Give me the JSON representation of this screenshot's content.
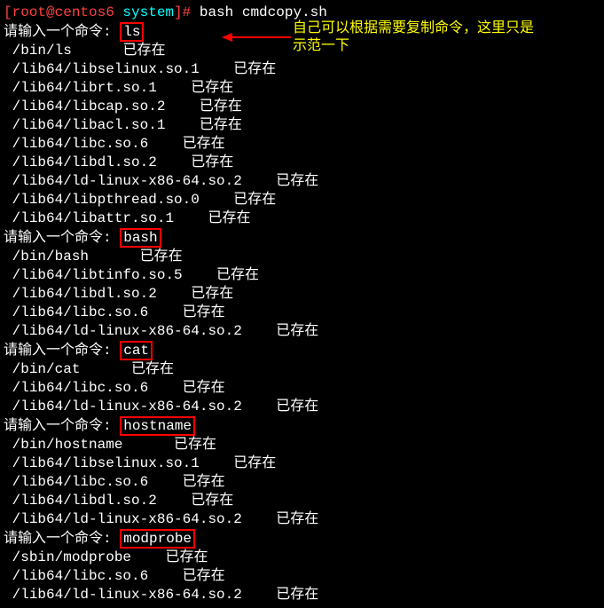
{
  "prompt_line": {
    "user_host": "[root@centos6 ",
    "dir": "system",
    "close": "]# ",
    "cmd": "bash cmdcopy.sh"
  },
  "input_prompt": "请输入一个命令: ",
  "exists": "已存在",
  "annotation": {
    "line1": "自己可以根据需要复制命令，这里只是",
    "line2": "示范一下"
  },
  "sections": [
    {
      "input": "ls",
      "items": [
        {
          "path": "/bin/ls",
          "pad": "      "
        },
        {
          "path": "/lib64/libselinux.so.1",
          "pad": "    "
        },
        {
          "path": "/lib64/librt.so.1",
          "pad": "    "
        },
        {
          "path": "/lib64/libcap.so.2",
          "pad": "    "
        },
        {
          "path": "/lib64/libacl.so.1",
          "pad": "    "
        },
        {
          "path": "/lib64/libc.so.6",
          "pad": "    "
        },
        {
          "path": "/lib64/libdl.so.2",
          "pad": "    "
        },
        {
          "path": "/lib64/ld-linux-x86-64.so.2",
          "pad": "    "
        },
        {
          "path": "/lib64/libpthread.so.0",
          "pad": "    "
        },
        {
          "path": "/lib64/libattr.so.1",
          "pad": "    "
        }
      ]
    },
    {
      "input": "bash",
      "items": [
        {
          "path": "/bin/bash",
          "pad": "      "
        },
        {
          "path": "/lib64/libtinfo.so.5",
          "pad": "    "
        },
        {
          "path": "/lib64/libdl.so.2",
          "pad": "    "
        },
        {
          "path": "/lib64/libc.so.6",
          "pad": "    "
        },
        {
          "path": "/lib64/ld-linux-x86-64.so.2",
          "pad": "    "
        }
      ]
    },
    {
      "input": "cat",
      "items": [
        {
          "path": "/bin/cat",
          "pad": "      "
        },
        {
          "path": "/lib64/libc.so.6",
          "pad": "    "
        },
        {
          "path": "/lib64/ld-linux-x86-64.so.2",
          "pad": "    "
        }
      ]
    },
    {
      "input": "hostname",
      "items": [
        {
          "path": "/bin/hostname",
          "pad": "      "
        },
        {
          "path": "/lib64/libselinux.so.1",
          "pad": "    "
        },
        {
          "path": "/lib64/libc.so.6",
          "pad": "    "
        },
        {
          "path": "/lib64/libdl.so.2",
          "pad": "    "
        },
        {
          "path": "/lib64/ld-linux-x86-64.so.2",
          "pad": "    "
        }
      ]
    },
    {
      "input": "modprobe",
      "items": [
        {
          "path": "/sbin/modprobe",
          "pad": "    "
        },
        {
          "path": "/lib64/libc.so.6",
          "pad": "    "
        },
        {
          "path": "/lib64/ld-linux-x86-64.so.2",
          "pad": "    "
        }
      ]
    }
  ]
}
